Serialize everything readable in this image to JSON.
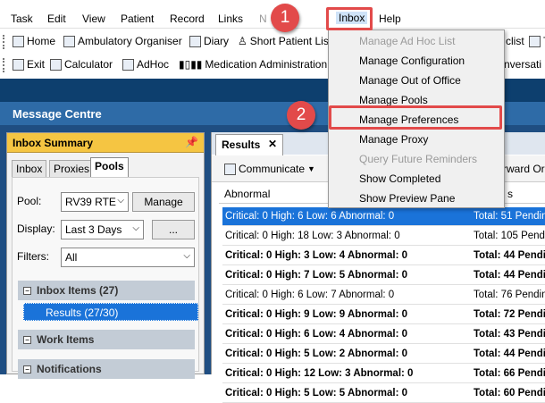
{
  "menubar": {
    "items": [
      "Task",
      "Edit",
      "View",
      "Patient",
      "Record",
      "Links",
      "N",
      "Inbox",
      "Help"
    ]
  },
  "toolbar1": {
    "items": [
      "Home",
      "Ambulatory Organiser",
      "Diary",
      "Short Patient Lis",
      "clist",
      "T"
    ]
  },
  "toolbar2": {
    "items": [
      "Exit",
      "Calculator",
      "AdHoc",
      "Medication Administration",
      "nversati"
    ]
  },
  "window_title": "Message Centre",
  "inbox_summary": {
    "title": "Inbox Summary",
    "tabs": [
      "Inbox",
      "Proxies",
      "Pools"
    ],
    "active_tab": "Pools",
    "pool_label": "Pool:",
    "pool_value": "RV39 RTE",
    "manage_button": "Manage",
    "display_label": "Display:",
    "display_value": "Last 3 Days",
    "ellipsis_button": "...",
    "filters_label": "Filters:",
    "filters_value": "All",
    "sections": [
      "Inbox Items (27)",
      "Work Items",
      "Notifications"
    ],
    "results_item": "Results (27/30)"
  },
  "results": {
    "tab_label": "Results",
    "close_glyph": "✕",
    "communicate_label": "Communicate",
    "forward_label": "rward Or",
    "column_abnormal": "Abnormal",
    "column_s": "s",
    "rows": [
      {
        "abnormal": "Critical: 0 High: 6 Low: 6 Abnormal: 0",
        "total": "Total: 51 Pendin",
        "selected": true,
        "bold": false
      },
      {
        "abnormal": "Critical: 0 High: 18 Low: 3 Abnormal: 0",
        "total": "Total: 105 Pendi",
        "selected": false,
        "bold": false
      },
      {
        "abnormal": "Critical: 0 High: 3 Low: 4 Abnormal: 0",
        "total": "Total: 44 Pendi",
        "selected": false,
        "bold": true
      },
      {
        "abnormal": "Critical: 0 High: 7 Low: 5 Abnormal: 0",
        "total": "Total: 44 Pendi",
        "selected": false,
        "bold": true
      },
      {
        "abnormal": "Critical: 0 High: 6 Low: 7 Abnormal: 0",
        "total": "Total: 76 Pendin",
        "selected": false,
        "bold": false
      },
      {
        "abnormal": "Critical: 0 High: 9 Low: 9 Abnormal: 0",
        "total": "Total: 72 Pendi",
        "selected": false,
        "bold": true
      },
      {
        "abnormal": "Critical: 0 High: 6 Low: 4 Abnormal: 0",
        "total": "Total: 43 Pendi",
        "selected": false,
        "bold": true
      },
      {
        "abnormal": "Critical: 0 High: 5 Low: 2 Abnormal: 0",
        "total": "Total: 44 Pendi",
        "selected": false,
        "bold": true
      },
      {
        "abnormal": "Critical: 0 High: 12 Low: 3 Abnormal: 0",
        "total": "Total: 66 Pendi",
        "selected": false,
        "bold": true
      },
      {
        "abnormal": "Critical: 0 High: 5 Low: 5 Abnormal: 0",
        "total": "Total: 60 Pendi",
        "selected": false,
        "bold": true
      }
    ]
  },
  "inbox_menu": {
    "items": [
      {
        "label": "Manage Ad Hoc List",
        "enabled": false
      },
      {
        "label": "Manage Configuration",
        "enabled": true
      },
      {
        "label": "Manage Out of Office",
        "enabled": true
      },
      {
        "label": "Manage Pools",
        "enabled": true
      },
      {
        "label": "Manage Preferences",
        "enabled": true
      },
      {
        "label": "Manage Proxy",
        "enabled": true
      },
      {
        "label": "Query Future Reminders",
        "enabled": false
      },
      {
        "label": "Show Completed",
        "enabled": true
      },
      {
        "label": "Show Preview Pane",
        "enabled": true
      }
    ]
  },
  "callouts": [
    "1",
    "2"
  ],
  "colors": {
    "highlight": "#e24a4a",
    "selection": "#1a73d9",
    "title_bar": "#2e6ba7",
    "summary_header": "#f5c542"
  }
}
